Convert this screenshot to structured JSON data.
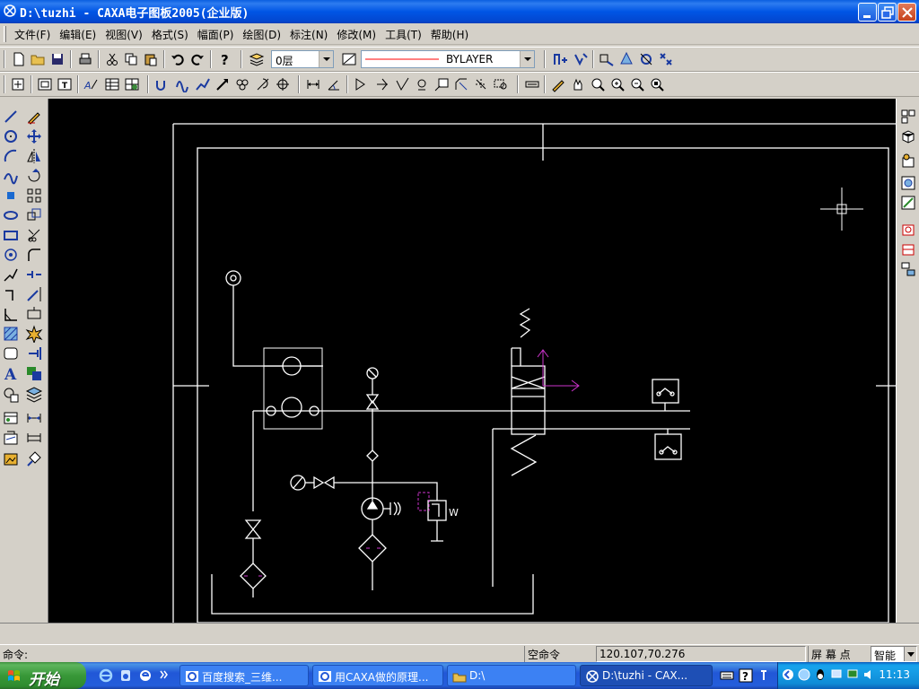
{
  "window": {
    "title": "D:\\tuzhi - CAXA电子图板2005(企业版)"
  },
  "menu": {
    "items": [
      "文件(F)",
      "编辑(E)",
      "视图(V)",
      "格式(S)",
      "幅面(P)",
      "绘图(D)",
      "标注(N)",
      "修改(M)",
      "工具(T)",
      "帮助(H)"
    ]
  },
  "toolbar": {
    "layer_value": "0层",
    "linetype_value": "BYLAYER",
    "linetype_color": "#ff0000"
  },
  "canvas": {
    "background": "#000000",
    "drawing_color": "#ffffff",
    "accent_color": "#cc33cc",
    "valve_label": "W"
  },
  "command": {
    "prompt": "命令:"
  },
  "status": {
    "command_state": "空命令",
    "coordinates": "120.107,70.276",
    "snap_mode": "屏 幕 点",
    "smart_mode": "智能"
  },
  "taskbar": {
    "start_label": "开始",
    "tasks": [
      {
        "label": "百度搜索_三维...",
        "icon": "ie-icon"
      },
      {
        "label": "用CAXA做的原理...",
        "icon": "ie-icon"
      },
      {
        "label": "D:\\",
        "icon": "folder-icon"
      },
      {
        "label": "D:\\tuzhi - CAX...",
        "icon": "caxa-icon"
      }
    ],
    "clock": "11:13"
  }
}
